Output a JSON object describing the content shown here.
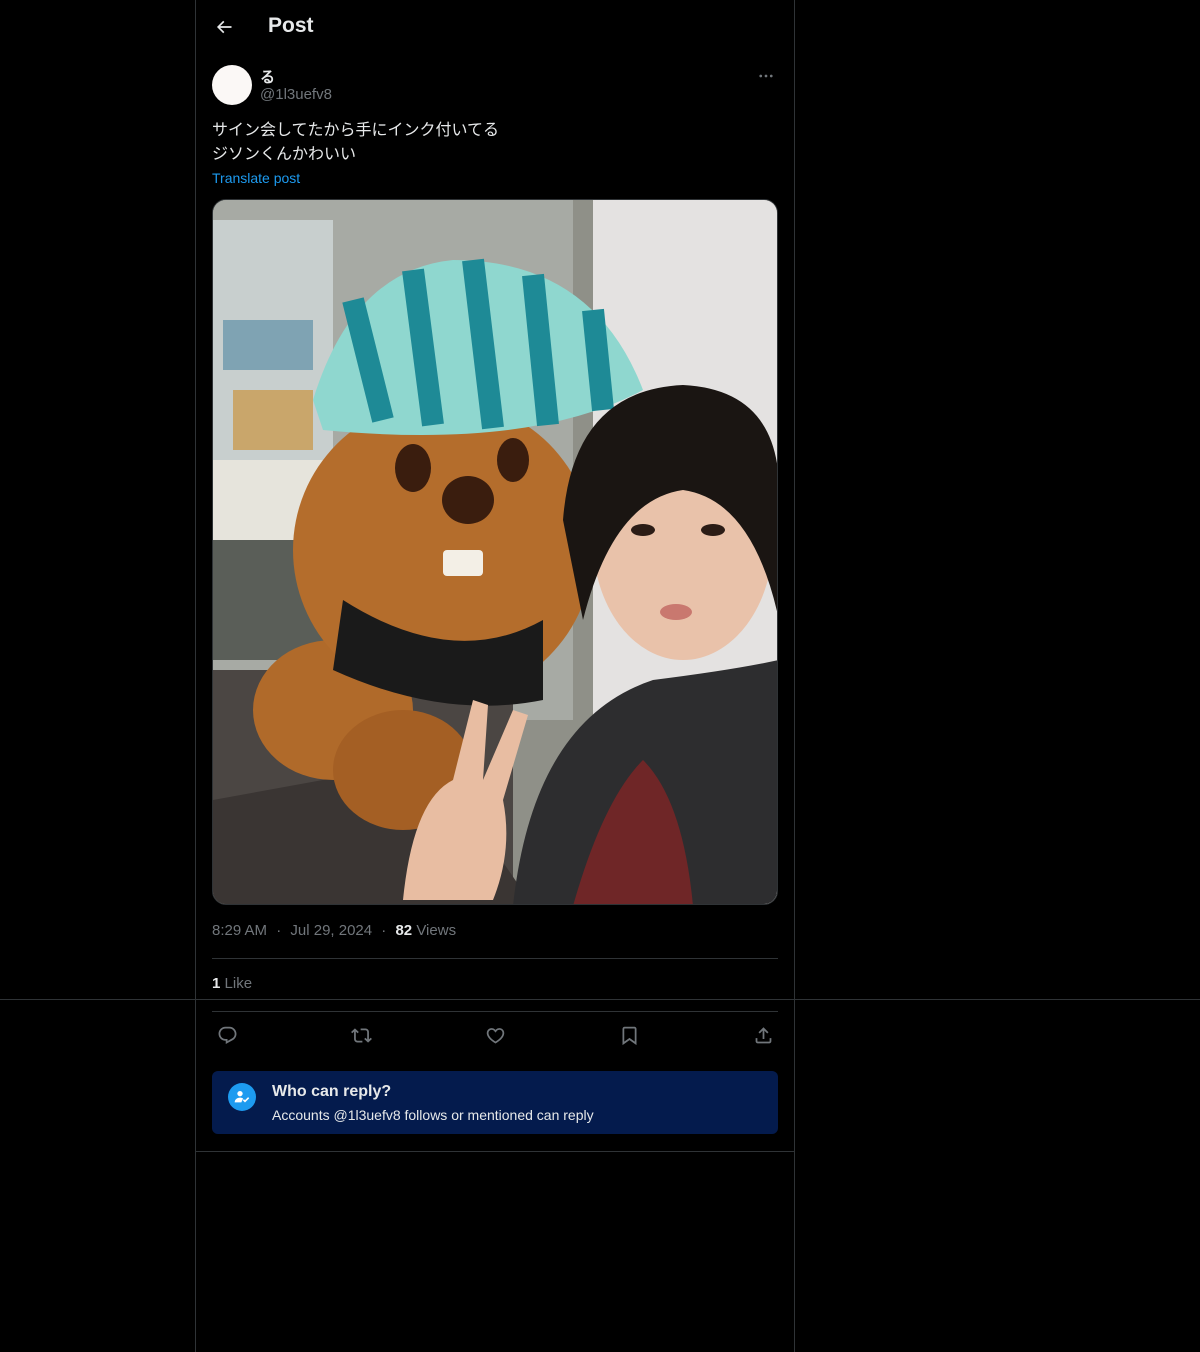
{
  "header": {
    "title": "Post",
    "back_icon": "arrow-left-icon"
  },
  "author": {
    "display_name": "る",
    "handle": "@1l3uefv8",
    "avatar_color": "#fbf8f6",
    "more_icon": "more-horizontal-icon"
  },
  "post": {
    "lines": [
      "サイン会してたから手にインク付いてる",
      "ジソンくんかわいい"
    ],
    "translate_label": "Translate post"
  },
  "meta": {
    "time": "8:29 AM",
    "date": "Jul 29, 2024",
    "views_count": "82",
    "views_label": "Views",
    "separator": "·"
  },
  "engagement": {
    "likes_count": "1",
    "likes_label": "Like"
  },
  "actions": [
    {
      "name": "reply",
      "icon": "reply-icon"
    },
    {
      "name": "repost",
      "icon": "repost-icon"
    },
    {
      "name": "like",
      "icon": "heart-icon"
    },
    {
      "name": "bookmark",
      "icon": "bookmark-icon"
    },
    {
      "name": "share",
      "icon": "share-icon"
    }
  ],
  "reply_restriction": {
    "title": "Who can reply?",
    "subtitle": "Accounts @1l3uefv8 follows or mentioned can reply",
    "icon": "user-check-icon",
    "accent": "#1d9bf0",
    "background": "#041b4d"
  },
  "colors": {
    "background": "#000000",
    "text": "#e7e9ea",
    "muted": "#71767b",
    "link": "#1d9bf0",
    "border": "#2f3336"
  }
}
